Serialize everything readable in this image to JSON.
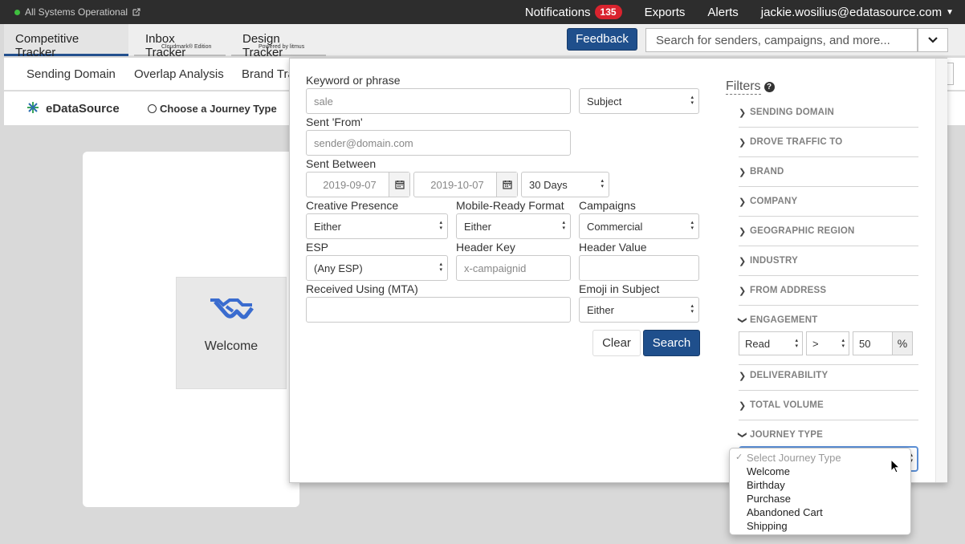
{
  "topbar": {
    "status": "All Systems Operational",
    "notifications_label": "Notifications",
    "notifications_count": "135",
    "exports": "Exports",
    "alerts": "Alerts",
    "user_email": "jackie.wosilius@edatasource.com"
  },
  "tabs": [
    {
      "label": "Competitive Tracker",
      "sub": ""
    },
    {
      "label": "Inbox Tracker",
      "sub": "Cloudmark® Edition"
    },
    {
      "label": "Design Tracker",
      "sub": "Powered by litmus"
    }
  ],
  "header": {
    "feedback": "Feedback",
    "search_placeholder": "Search for senders, campaigns, and more..."
  },
  "subnav": {
    "items": [
      "Sending Domain",
      "Overlap Analysis",
      "Brand Tra"
    ]
  },
  "brandbar": {
    "name": "eDataSource",
    "journey_choice": "Choose a Journey Type"
  },
  "welcome_tile": {
    "label": "Welcome"
  },
  "search_form": {
    "keyword_label": "Keyword or phrase",
    "keyword_placeholder": "sale",
    "keyword_scope": "Subject",
    "sent_from_label": "Sent 'From'",
    "sent_from_placeholder": "sender@domain.com",
    "sent_between_label": "Sent Between",
    "date_from": "2019-09-07",
    "date_to": "2019-10-07",
    "range": "30 Days",
    "creative_presence_label": "Creative Presence",
    "creative_presence_value": "Either",
    "mobile_ready_label": "Mobile-Ready Format",
    "mobile_ready_value": "Either",
    "campaigns_label": "Campaigns",
    "campaigns_value": "Commercial",
    "esp_label": "ESP",
    "esp_value": "(Any ESP)",
    "header_key_label": "Header Key",
    "header_key_placeholder": "x-campaignid",
    "header_value_label": "Header Value",
    "mta_label": "Received Using (MTA)",
    "emoji_label": "Emoji in Subject",
    "emoji_value": "Either",
    "clear": "Clear",
    "search": "Search"
  },
  "filters": {
    "title": "Filters",
    "help": "?",
    "sections": [
      "SENDING DOMAIN",
      "DROVE TRAFFIC TO",
      "BRAND",
      "COMPANY",
      "GEOGRAPHIC REGION",
      "INDUSTRY",
      "FROM ADDRESS",
      "ENGAGEMENT",
      "DELIVERABILITY",
      "TOTAL VOLUME",
      "JOURNEY TYPE"
    ],
    "engagement": {
      "metric": "Read",
      "operator": ">",
      "value": "50",
      "unit": "%"
    }
  },
  "journey_dropdown": {
    "check": "✓",
    "placeholder": "Select Journey Type",
    "options": [
      "Welcome",
      "Birthday",
      "Purchase",
      "Abandoned Cart",
      "Shipping"
    ]
  },
  "colors": {
    "primary": "#1f4f8c",
    "topbar": "#2d2d2d",
    "badge": "#d9232e",
    "status": "#3fbf3f"
  }
}
